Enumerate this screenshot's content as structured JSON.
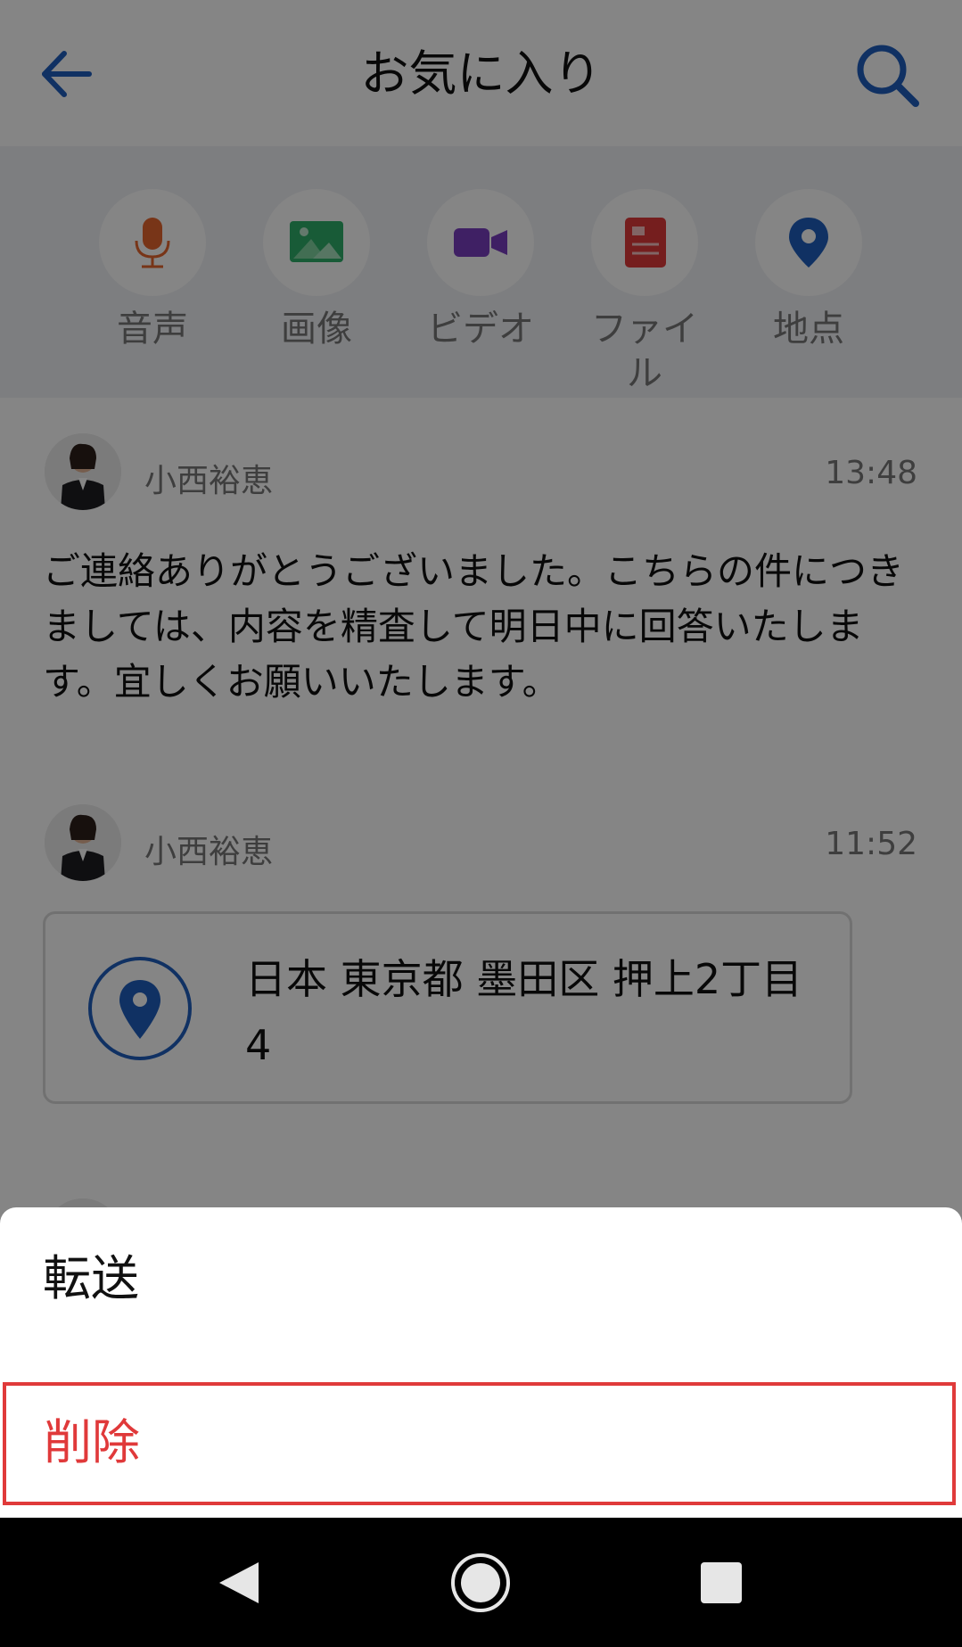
{
  "header": {
    "title": "お気に入り"
  },
  "categories": [
    {
      "label": "音声",
      "icon": "microphone-icon",
      "color": "#e6672f"
    },
    {
      "label": "画像",
      "icon": "image-icon",
      "color": "#2fae6a"
    },
    {
      "label": "ビデオ",
      "icon": "video-camera-icon",
      "color": "#7a3fc0"
    },
    {
      "label": "ファイル",
      "icon": "document-icon",
      "color": "#e03a3a"
    },
    {
      "label": "地点",
      "icon": "location-pin-icon",
      "color": "#1f5fbf"
    }
  ],
  "favorites": [
    {
      "sender": "小西裕恵",
      "time": "13:48",
      "message": "ご連絡ありがとうございました。こちらの件につきましては、内容を精査して明日中に回答いたします。宜しくお願いいたします。"
    },
    {
      "sender": "小西裕恵",
      "time": "11:52",
      "location": "日本 東京都 墨田区 押上2丁目 4"
    }
  ],
  "sheet": {
    "forward": "転送",
    "delete": "削除"
  },
  "colors": {
    "accent": "#1f5fbf",
    "danger": "#e03a3a"
  }
}
